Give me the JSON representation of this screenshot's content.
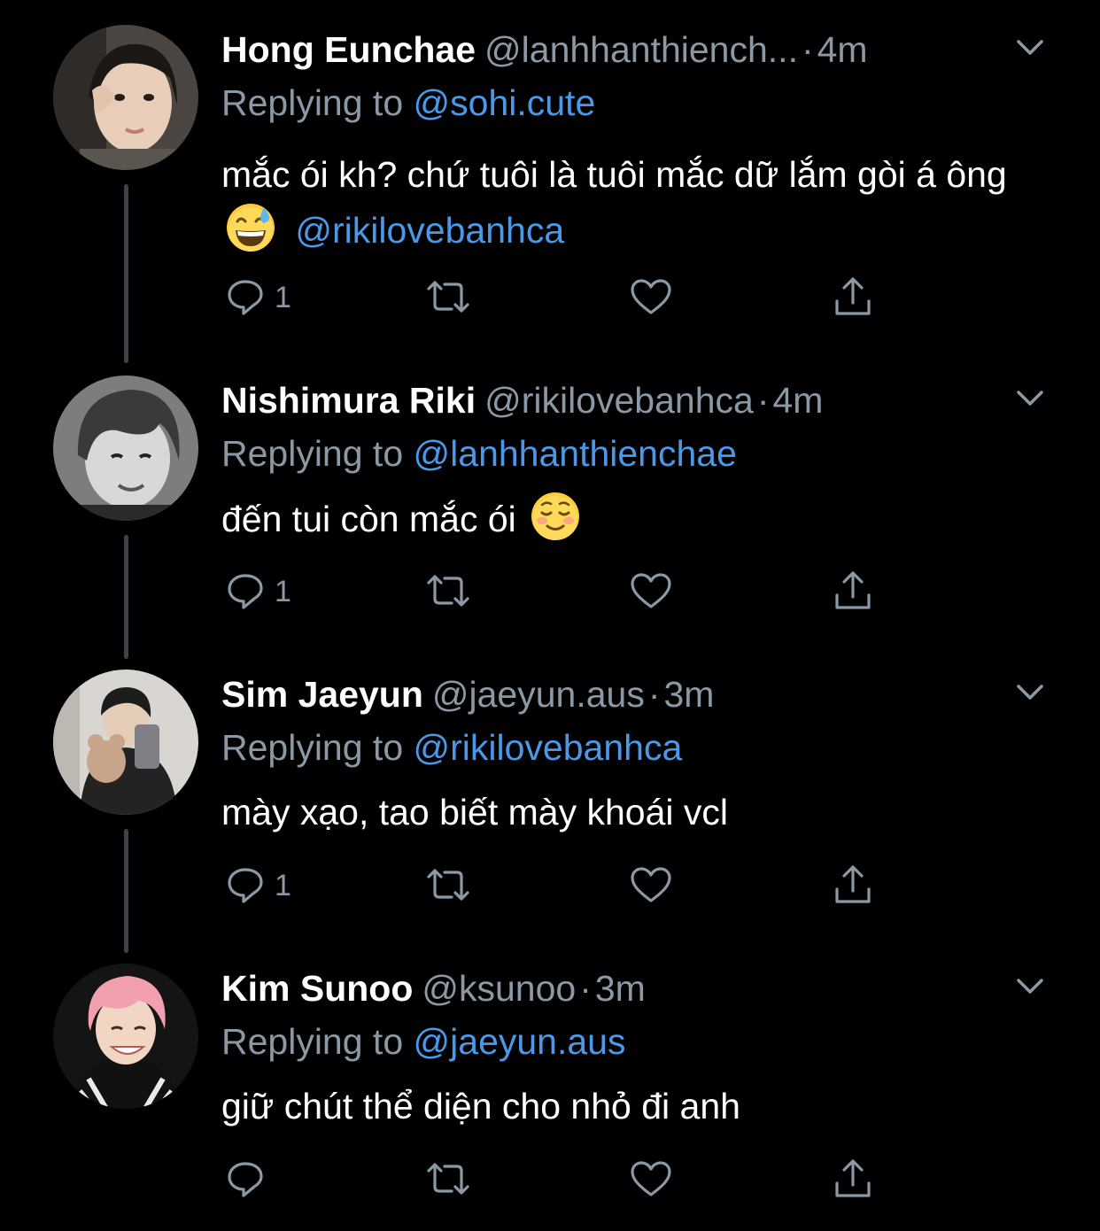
{
  "colors": {
    "background": "#000000",
    "text_primary": "#ffffff",
    "text_secondary": "#8b98a5",
    "mention": "#4a99e9",
    "thread_line": "#3d4349"
  },
  "reply_prefix": "Replying to",
  "tweets": [
    {
      "name": "Hong Eunchae",
      "handle": "@lanhhanthiench...",
      "dot": "·",
      "time": "4m",
      "reply_to": "@sohi.cute",
      "text_before": "mắc ói kh? chứ tuôi là tuôi mắc dữ lắm gòi á ông",
      "emoji": "grinning-face-with-sweat",
      "text_mention": "@rikilovebanhca",
      "reply_count": "1"
    },
    {
      "name": "Nishimura Riki",
      "handle": "@rikilovebanhca",
      "dot": "·",
      "time": "4m",
      "reply_to": "@lanhhanthienchae",
      "text_before": "đến tui còn mắc ói",
      "emoji": "smiling-face",
      "text_mention": "",
      "reply_count": "1"
    },
    {
      "name": "Sim Jaeyun",
      "handle": "@jaeyun.aus",
      "dot": "·",
      "time": "3m",
      "reply_to": "@rikilovebanhca",
      "text_before": "mày xạo, tao biết mày khoái vcl",
      "emoji": "",
      "text_mention": "",
      "reply_count": "1"
    },
    {
      "name": "Kim Sunoo",
      "handle": "@ksunoo",
      "dot": "·",
      "time": "3m",
      "reply_to": "@jaeyun.aus",
      "text_before": "giữ chút thể diện cho nhỏ đi anh",
      "emoji": "",
      "text_mention": "",
      "reply_count": ""
    }
  ],
  "icons": {
    "reply": "reply-icon",
    "retweet": "retweet-icon",
    "like": "heart-icon",
    "share": "share-icon",
    "more": "chevron-down-icon"
  }
}
